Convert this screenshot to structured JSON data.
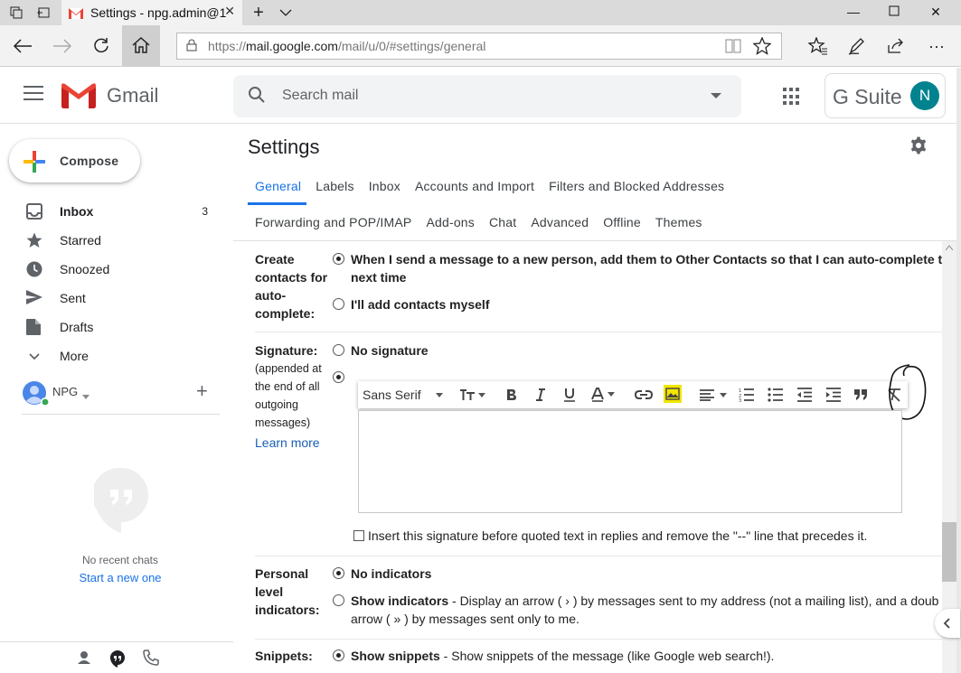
{
  "browser": {
    "tab_title": "Settings - npg.admin@1",
    "url_prefix": "https://",
    "url_domain": "mail.google.com",
    "url_path": "/mail/u/0/#settings/general"
  },
  "header": {
    "app_name": "Gmail",
    "search_placeholder": "Search mail",
    "gsuite_label": "G Suite",
    "avatar_letter": "N"
  },
  "sidebar": {
    "compose_label": "Compose",
    "items": [
      {
        "label": "Inbox",
        "count": "3",
        "icon": "inbox-icon"
      },
      {
        "label": "Starred",
        "count": "",
        "icon": "star-icon"
      },
      {
        "label": "Snoozed",
        "count": "",
        "icon": "clock-icon"
      },
      {
        "label": "Sent",
        "count": "",
        "icon": "send-icon"
      },
      {
        "label": "Drafts",
        "count": "",
        "icon": "draft-icon"
      },
      {
        "label": "More",
        "count": "",
        "icon": "chevron-down-icon"
      }
    ],
    "hangouts_user": "NPG",
    "no_chats": "No recent chats",
    "start_new": "Start a new one"
  },
  "settings": {
    "title": "Settings",
    "tabs_row1": [
      "General",
      "Labels",
      "Inbox",
      "Accounts and Import",
      "Filters and Blocked Addresses"
    ],
    "tabs_row2": [
      "Forwarding and POP/IMAP",
      "Add-ons",
      "Chat",
      "Advanced",
      "Offline",
      "Themes"
    ],
    "active_tab": "General",
    "contacts": {
      "label": "Create contacts for auto-complete:",
      "label_lines": [
        "Create",
        "contacts for",
        "auto-",
        "complete:"
      ],
      "opt1_line1": "When I send a message to a new person, add them to Other Contacts so that I can auto-complete to th",
      "opt1_line2": "next time",
      "opt2": "I'll add contacts myself",
      "selected": 1
    },
    "signature": {
      "label": "Signature:",
      "sub_lines": [
        "(appended at",
        "the end of all",
        "outgoing",
        "messages)"
      ],
      "learn_more": "Learn more",
      "opt_none": "No signature",
      "font": "Sans Serif",
      "checkbox_label": "Insert this signature before quoted text in replies and remove the \"--\" line that precedes it.",
      "checkbox_checked": false
    },
    "indicators": {
      "label_lines": [
        "Personal",
        "level",
        "indicators:"
      ],
      "opt1": "No indicators",
      "opt2_bold": "Show indicators",
      "opt2_rest": " - Display an arrow ( › ) by messages sent to my address (not a mailing list), and a doub",
      "opt2_line2": "arrow ( » ) by messages sent only to me."
    },
    "snippets": {
      "label": "Snippets:",
      "opt1_bold": "Show snippets",
      "opt1_rest": " - Show snippets of the message (like Google web search!)."
    }
  },
  "colors": {
    "accent": "#1a73e8",
    "gmail_red": "#ea4335",
    "avatar": "#00838f",
    "highlight": "#f2e600"
  }
}
